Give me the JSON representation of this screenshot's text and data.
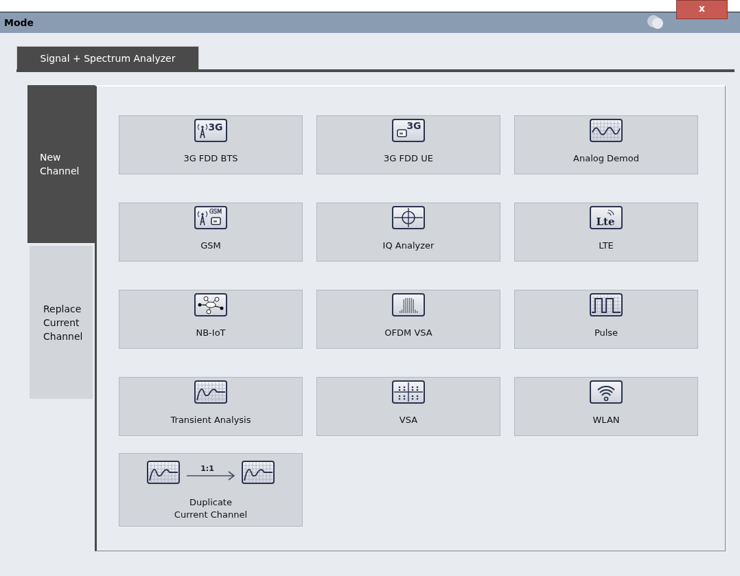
{
  "window": {
    "title": "Mode",
    "close": "x"
  },
  "tabs": [
    {
      "label": "Signal + Spectrum Analyzer",
      "selected": true
    }
  ],
  "side_tabs": [
    {
      "label": "New Channel",
      "selected": true
    },
    {
      "label": "Replace Current Channel",
      "selected": false
    }
  ],
  "applications": [
    {
      "label": "3G FDD BTS",
      "kind": "bts3g",
      "icon_text": "3G"
    },
    {
      "label": "3G FDD UE",
      "kind": "ue3g",
      "icon_text": "3G"
    },
    {
      "label": "Analog Demod",
      "kind": "wave"
    },
    {
      "label": "GSM",
      "kind": "gsm",
      "icon_text": "GSM"
    },
    {
      "label": "IQ Analyzer",
      "kind": "iq"
    },
    {
      "label": "LTE",
      "kind": "lte",
      "icon_text": "Lte"
    },
    {
      "label": "NB-IoT",
      "kind": "iot"
    },
    {
      "label": "OFDM VSA",
      "kind": "ofdm"
    },
    {
      "label": "Pulse",
      "kind": "pulse"
    },
    {
      "label": "Transient Analysis",
      "kind": "transient"
    },
    {
      "label": "VSA",
      "kind": "vsa"
    },
    {
      "label": "WLAN",
      "kind": "wlan"
    }
  ],
  "duplicate": {
    "label": "Duplicate\nCurrent Channel",
    "ratio": "1:1"
  }
}
